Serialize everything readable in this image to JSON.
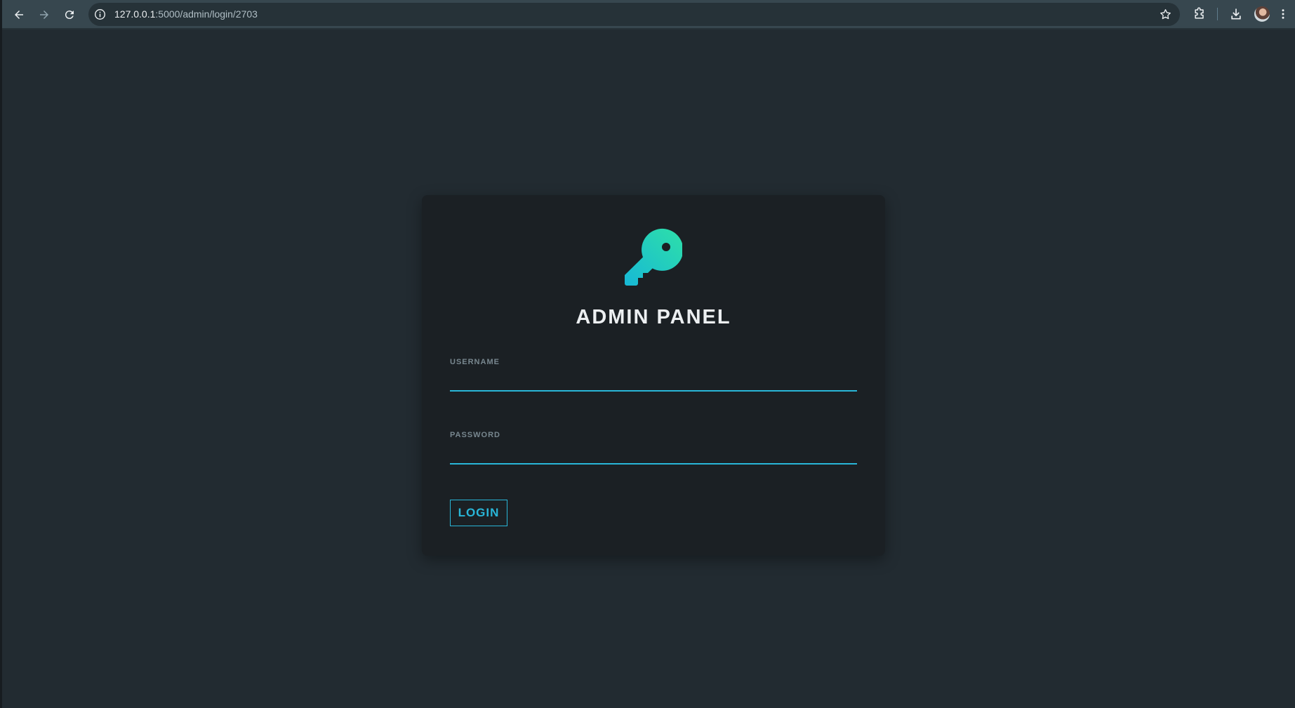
{
  "browser": {
    "url_host": "127.0.0.1",
    "url_path": ":5000/admin/login/2703",
    "icons": {
      "back": "arrow-left-icon",
      "forward": "arrow-right-icon",
      "reload": "reload-icon",
      "site_info": "info-icon",
      "bookmark": "star-icon",
      "extensions": "puzzle-icon",
      "downloads": "download-icon",
      "menu": "kebab-menu-icon"
    }
  },
  "login": {
    "icon": "key-icon",
    "title": "ADMIN PANEL",
    "username_label": "USERNAME",
    "username_value": "",
    "password_label": "PASSWORD",
    "password_value": "",
    "button_label": "LOGIN"
  },
  "colors": {
    "background": "#222b31",
    "card": "#1b2024",
    "accent": "#29b6d8",
    "key_gradient_start": "#2ee0a8",
    "key_gradient_end": "#17b8d6"
  }
}
